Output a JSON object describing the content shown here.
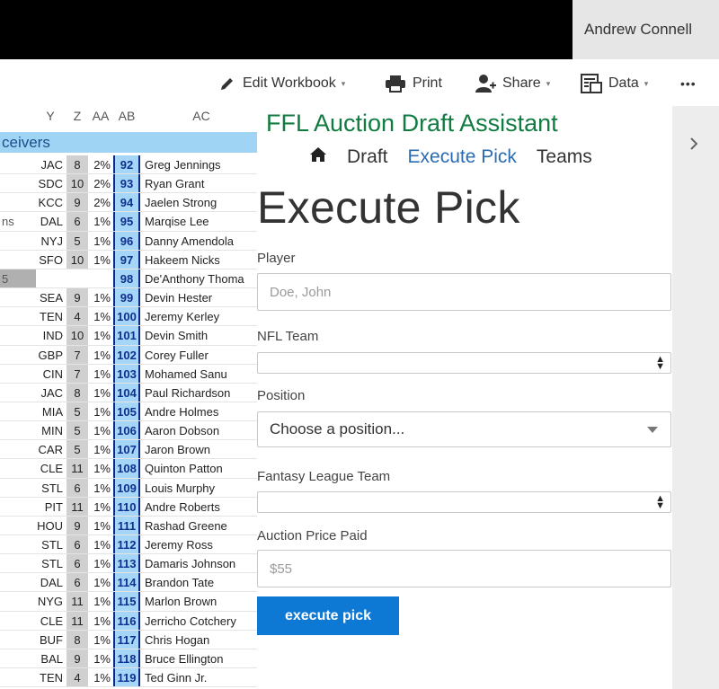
{
  "topbar": {
    "user_name": "Andrew Connell"
  },
  "ribbon": {
    "edit_workbook": "Edit Workbook",
    "print": "Print",
    "share": "Share",
    "data": "Data",
    "more": "•••"
  },
  "sheet": {
    "col_headers": [
      "Y",
      "Z",
      "AA",
      "AB",
      "AC"
    ],
    "banner": "ceivers",
    "rows": [
      {
        "x": "",
        "y": "JAC",
        "z": "8",
        "aa": "2%",
        "ab": "92",
        "ac": "Greg Jennings"
      },
      {
        "x": "",
        "y": "SDC",
        "z": "10",
        "aa": "2%",
        "ab": "93",
        "ac": "Ryan Grant"
      },
      {
        "x": "",
        "y": "KCC",
        "z": "9",
        "aa": "2%",
        "ab": "94",
        "ac": "Jaelen Strong"
      },
      {
        "x": "ns",
        "y": "DAL",
        "z": "6",
        "aa": "1%",
        "ab": "95",
        "ac": "Marqise Lee"
      },
      {
        "x": "",
        "y": "NYJ",
        "z": "5",
        "aa": "1%",
        "ab": "96",
        "ac": "Danny Amendola"
      },
      {
        "x": "",
        "y": "SFO",
        "z": "10",
        "aa": "1%",
        "ab": "97",
        "ac": "Hakeem Nicks"
      },
      {
        "x": "5",
        "y": "",
        "z": "",
        "aa": "",
        "ab": "98",
        "ac": "De'Anthony Thoma",
        "gray": true
      },
      {
        "x": "",
        "y": "SEA",
        "z": "9",
        "aa": "1%",
        "ab": "99",
        "ac": "Devin Hester"
      },
      {
        "x": "",
        "y": "TEN",
        "z": "4",
        "aa": "1%",
        "ab": "100",
        "ac": "Jeremy Kerley"
      },
      {
        "x": "",
        "y": "IND",
        "z": "10",
        "aa": "1%",
        "ab": "101",
        "ac": "Devin Smith"
      },
      {
        "x": "",
        "y": "GBP",
        "z": "7",
        "aa": "1%",
        "ab": "102",
        "ac": "Corey Fuller"
      },
      {
        "x": "",
        "y": "CIN",
        "z": "7",
        "aa": "1%",
        "ab": "103",
        "ac": "Mohamed Sanu"
      },
      {
        "x": "",
        "y": "JAC",
        "z": "8",
        "aa": "1%",
        "ab": "104",
        "ac": "Paul Richardson"
      },
      {
        "x": "",
        "y": "MIA",
        "z": "5",
        "aa": "1%",
        "ab": "105",
        "ac": "Andre Holmes"
      },
      {
        "x": "",
        "y": "MIN",
        "z": "5",
        "aa": "1%",
        "ab": "106",
        "ac": "Aaron Dobson"
      },
      {
        "x": "",
        "y": "CAR",
        "z": "5",
        "aa": "1%",
        "ab": "107",
        "ac": "Jaron Brown"
      },
      {
        "x": "",
        "y": "CLE",
        "z": "11",
        "aa": "1%",
        "ab": "108",
        "ac": "Quinton Patton"
      },
      {
        "x": "",
        "y": "STL",
        "z": "6",
        "aa": "1%",
        "ab": "109",
        "ac": "Louis Murphy"
      },
      {
        "x": "",
        "y": "PIT",
        "z": "11",
        "aa": "1%",
        "ab": "110",
        "ac": "Andre Roberts"
      },
      {
        "x": "",
        "y": "HOU",
        "z": "9",
        "aa": "1%",
        "ab": "111",
        "ac": "Rashad Greene"
      },
      {
        "x": "",
        "y": "STL",
        "z": "6",
        "aa": "1%",
        "ab": "112",
        "ac": "Jeremy Ross"
      },
      {
        "x": "",
        "y": "STL",
        "z": "6",
        "aa": "1%",
        "ab": "113",
        "ac": "Damaris Johnson"
      },
      {
        "x": "",
        "y": "DAL",
        "z": "6",
        "aa": "1%",
        "ab": "114",
        "ac": "Brandon Tate"
      },
      {
        "x": "",
        "y": "NYG",
        "z": "11",
        "aa": "1%",
        "ab": "115",
        "ac": "Marlon Brown"
      },
      {
        "x": "",
        "y": "CLE",
        "z": "11",
        "aa": "1%",
        "ab": "116",
        "ac": "Jerricho Cotchery"
      },
      {
        "x": "",
        "y": "BUF",
        "z": "8",
        "aa": "1%",
        "ab": "117",
        "ac": "Chris Hogan"
      },
      {
        "x": "",
        "y": "BAL",
        "z": "9",
        "aa": "1%",
        "ab": "118",
        "ac": "Bruce Ellington"
      },
      {
        "x": "",
        "y": "TEN",
        "z": "4",
        "aa": "1%",
        "ab": "119",
        "ac": "Ted Ginn Jr."
      }
    ]
  },
  "panel": {
    "app_title": "FFL Auction Draft Assistant",
    "nav": {
      "draft": "Draft",
      "execute_pick": "Execute Pick",
      "teams": "Teams"
    },
    "page_title": "Execute Pick",
    "player_label": "Player",
    "player_placeholder": "Doe, John",
    "nfl_team_label": "NFL Team",
    "position_label": "Position",
    "position_value": "Choose a position...",
    "fantasy_team_label": "Fantasy League Team",
    "price_label": "Auction Price Paid",
    "price_placeholder": "$55",
    "execute_button": "execute pick"
  }
}
